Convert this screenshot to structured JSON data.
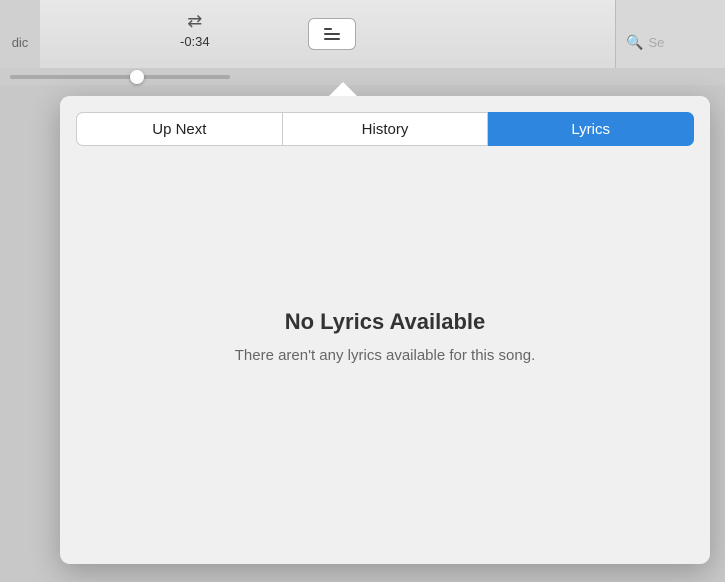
{
  "topbar": {
    "time_display": "-0:34",
    "left_text": "dic"
  },
  "search": {
    "placeholder": "Se",
    "icon": "🔍"
  },
  "queue_button": {
    "label": "queue-button"
  },
  "tabs": [
    {
      "id": "up-next",
      "label": "Up Next",
      "active": false
    },
    {
      "id": "history",
      "label": "History",
      "active": false
    },
    {
      "id": "lyrics",
      "label": "Lyrics",
      "active": true
    }
  ],
  "lyrics_panel": {
    "no_lyrics_title": "No Lyrics Available",
    "no_lyrics_subtitle": "There aren't any lyrics available for this song."
  },
  "colors": {
    "active_tab_bg": "#2e86de",
    "active_tab_text": "#ffffff",
    "inactive_tab_bg": "#ffffff",
    "inactive_tab_text": "#222222"
  }
}
